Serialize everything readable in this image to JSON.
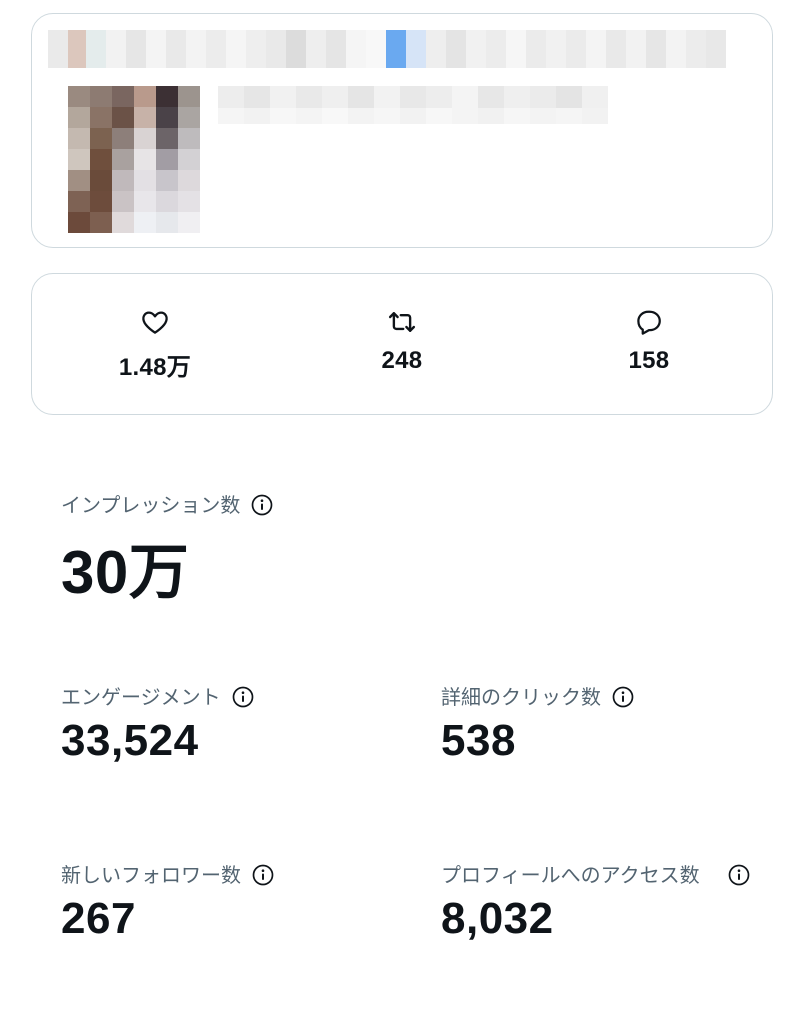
{
  "engagement_bar": {
    "likes": "1.48万",
    "reposts": "248",
    "replies": "158",
    "icons": [
      "heart-icon",
      "repost-icon",
      "reply-icon"
    ]
  },
  "metrics": {
    "impressions": {
      "label": "インプレッション数",
      "value": "30万"
    },
    "engagements": {
      "label": "エンゲージメント",
      "value": "33,524"
    },
    "detail_clicks": {
      "label": "詳細のクリック数",
      "value": "538"
    },
    "new_followers": {
      "label": "新しいフォロワー数",
      "value": "267"
    },
    "profile_visits": {
      "label": "プロフィールへのアクセス数",
      "value": "8,032"
    }
  },
  "colors": {
    "text": "#0f1419",
    "muted": "#536471",
    "border": "#cfd9de",
    "link_blue": "#6aa9f0"
  }
}
